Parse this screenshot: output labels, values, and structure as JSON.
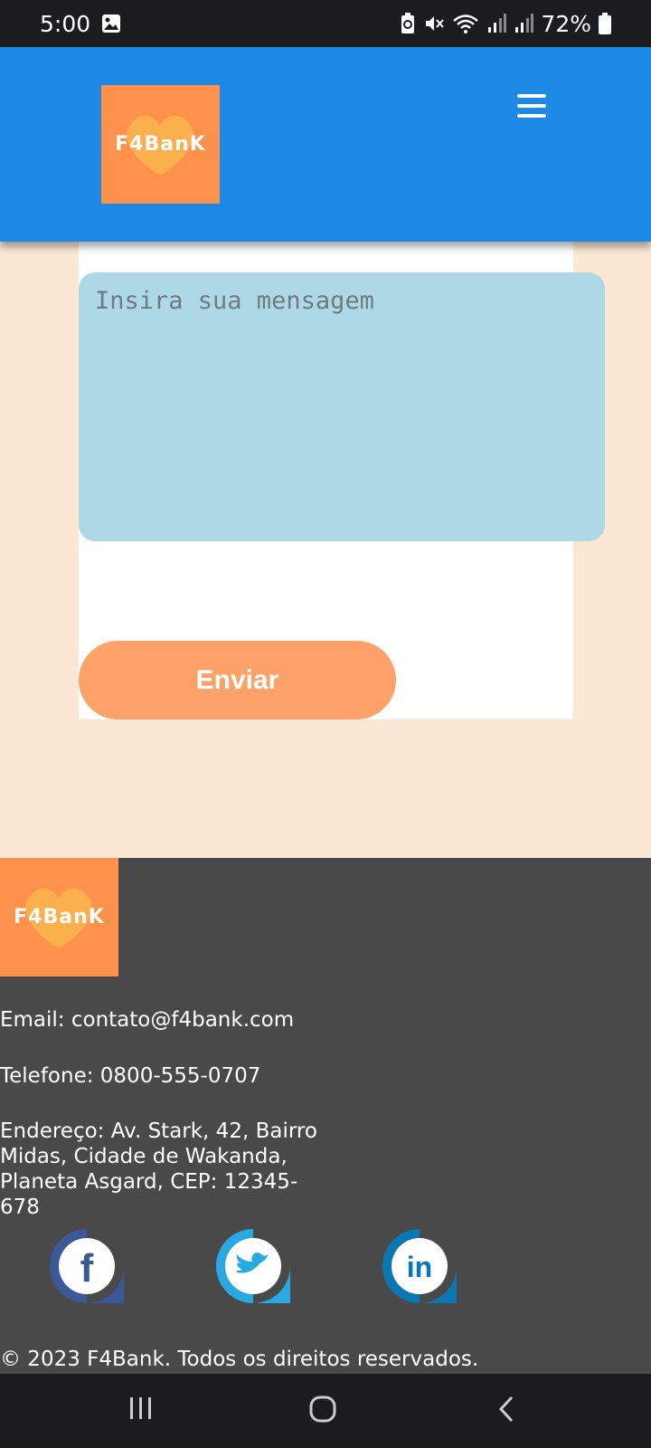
{
  "status_bar": {
    "time": "5:00",
    "battery": "72%",
    "icons": [
      "gallery-icon",
      "battery-saver-icon",
      "mute-icon",
      "wifi-icon",
      "signal-icon",
      "signal-icon",
      "battery-icon"
    ]
  },
  "header": {
    "logo_text": "F4BanK",
    "menu_icon": "hamburger-menu-icon"
  },
  "form": {
    "message_placeholder": "Insira sua mensagem",
    "message_value": "",
    "send_label": "Enviar"
  },
  "footer": {
    "logo_text": "F4BanK",
    "email": "Email: contato@f4bank.com",
    "phone": "Telefone: 0800-555-0707",
    "address_line1": "Endereço: Av. Stark, 42, Bairro",
    "address_line2": "Midas, Cidade de Wakanda,",
    "address_line3": "Planeta Asgard, CEP: 12345-678",
    "social": [
      {
        "name": "facebook-icon",
        "color": "#3b5998"
      },
      {
        "name": "twitter-icon",
        "color": "#29a9e1"
      },
      {
        "name": "linkedin-icon",
        "color": "#0a77b5"
      }
    ],
    "copyright": "© 2023 F4Bank. Todos os direitos reservados."
  },
  "colors": {
    "header": "#1e88e5",
    "page_bg": "#fbe7d3",
    "logo_bg": "#fe914b",
    "message_bg": "#add8e6",
    "button_bg": "#fea26a",
    "footer_bg": "#4a4949"
  },
  "nav_bar": {
    "icons": [
      "recents-icon",
      "home-icon",
      "back-icon"
    ]
  }
}
